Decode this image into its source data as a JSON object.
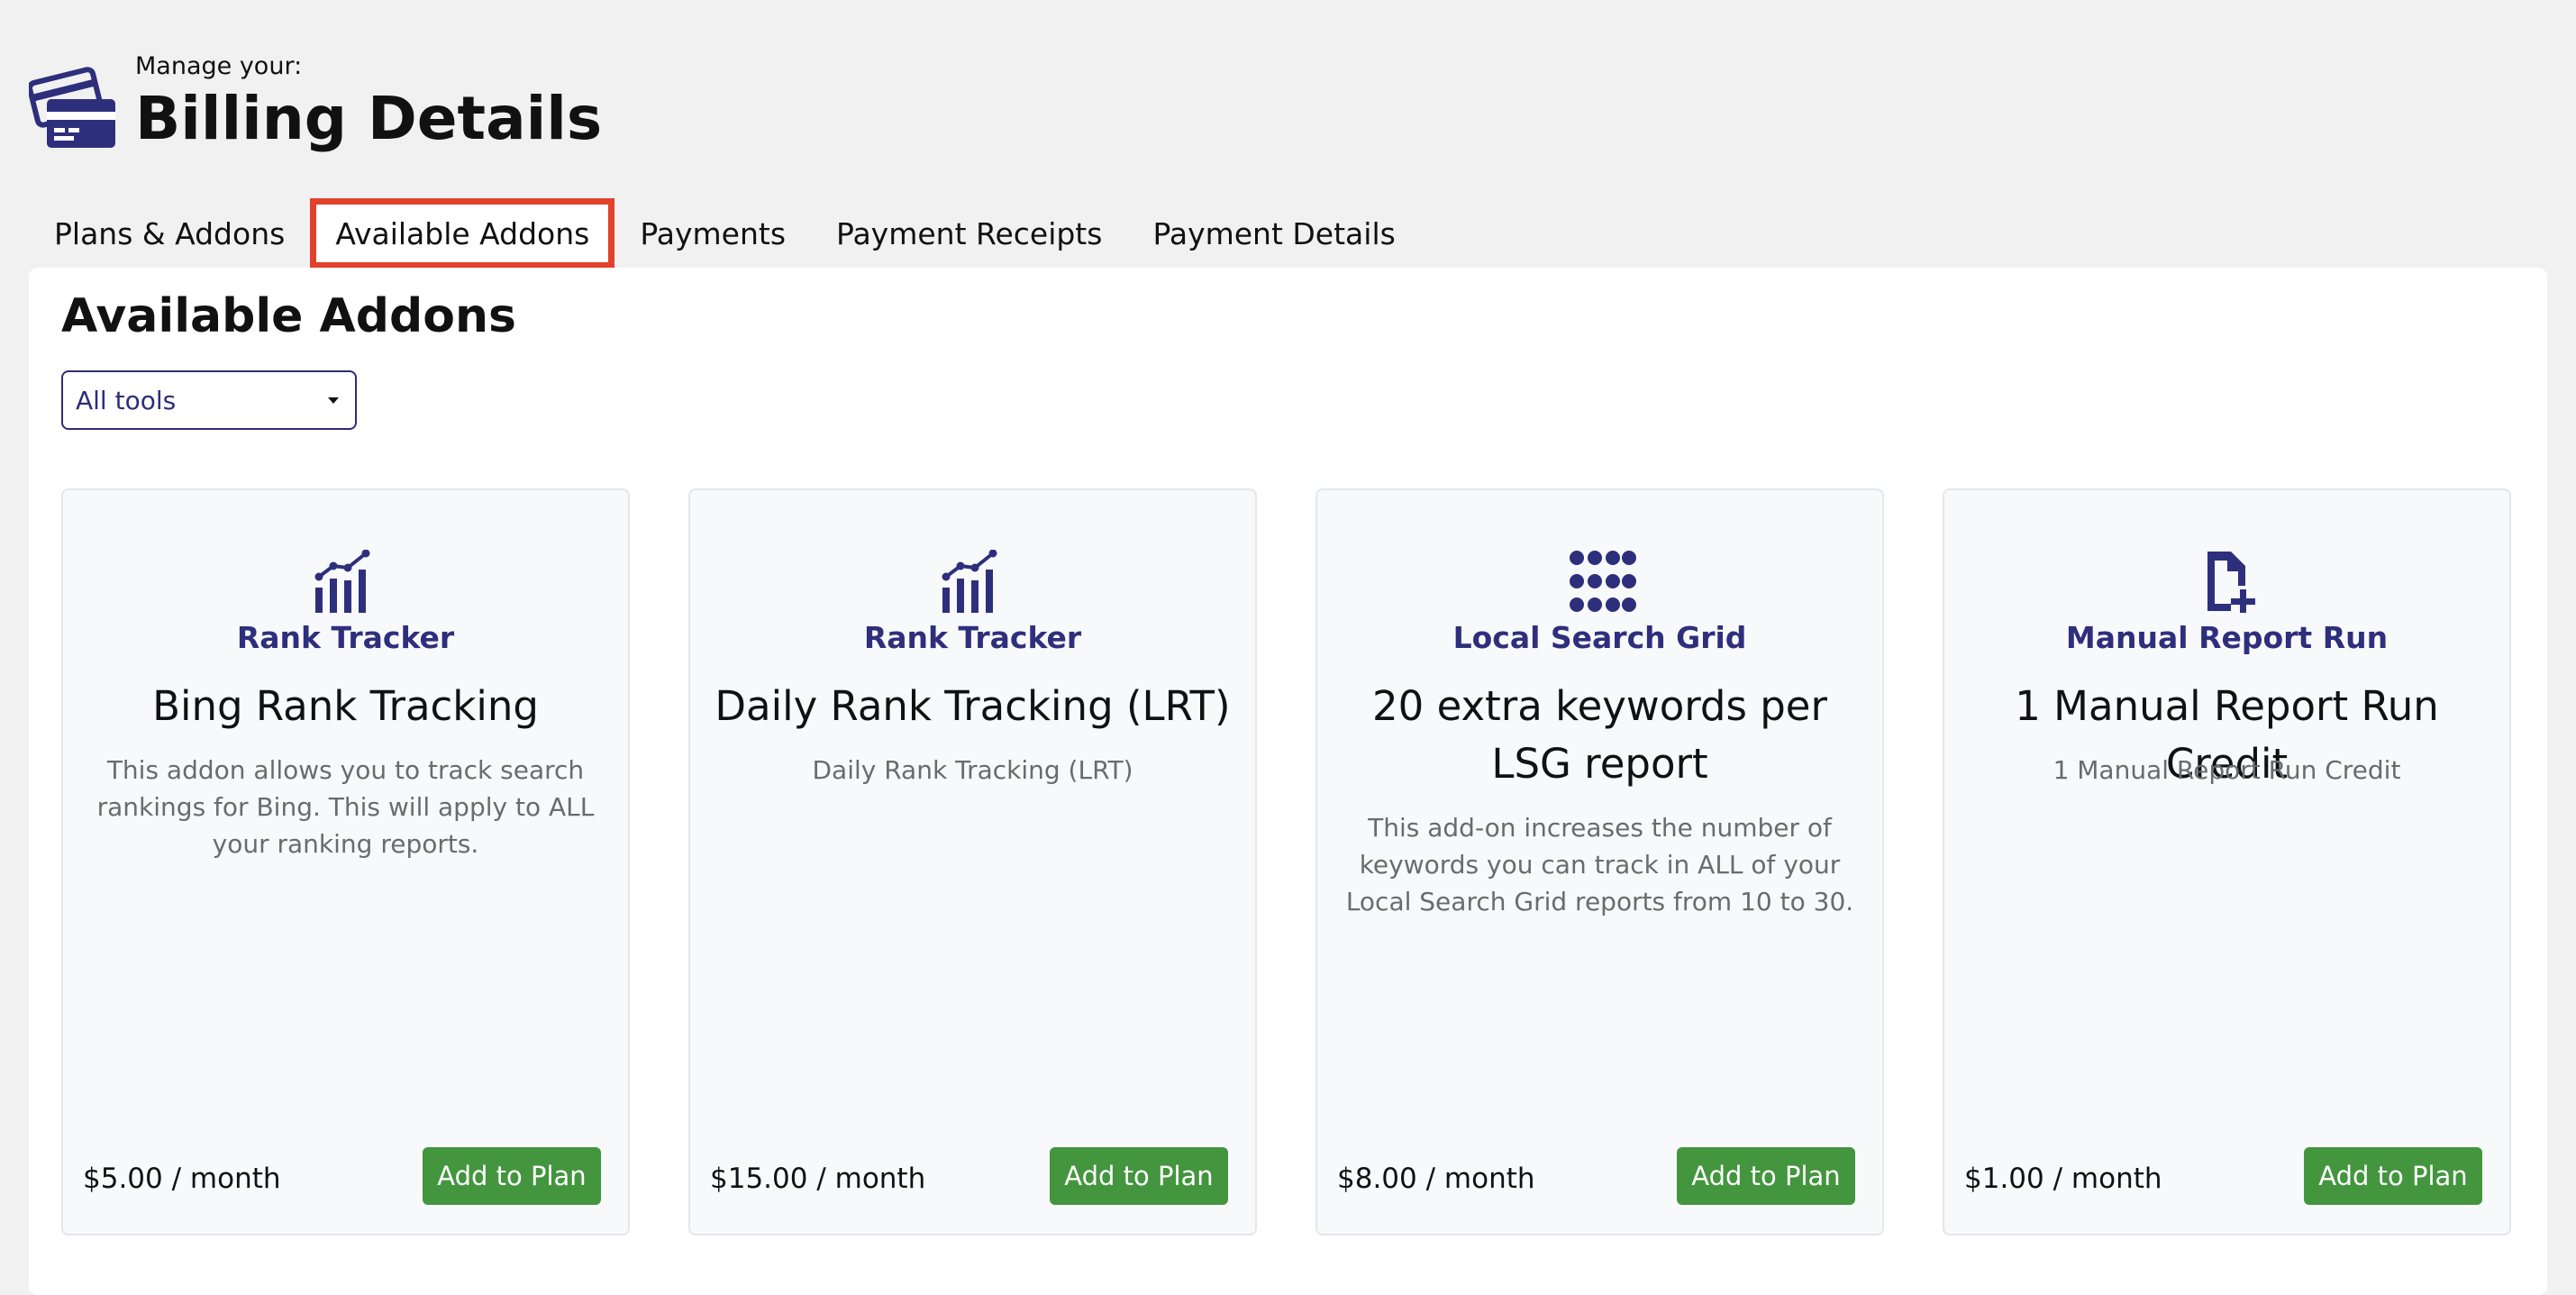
{
  "header": {
    "subtitle": "Manage your:",
    "title": "Billing Details",
    "icon": "credit-card-icon"
  },
  "tabs": [
    {
      "label": "Plans & Addons",
      "active": false
    },
    {
      "label": "Available Addons",
      "active": true
    },
    {
      "label": "Payments",
      "active": false
    },
    {
      "label": "Payment Receipts",
      "active": false
    },
    {
      "label": "Payment Details",
      "active": false
    }
  ],
  "panel": {
    "title": "Available Addons",
    "filter": {
      "selected": "All tools"
    }
  },
  "addons": [
    {
      "icon": "bar-chart-icon",
      "category": "Rank Tracker",
      "name": "Bing Rank Tracking",
      "description": "This addon allows you to track search rankings for Bing. This will apply to ALL your ranking reports.",
      "price": "$5.00 / month",
      "button": "Add to Plan"
    },
    {
      "icon": "bar-chart-icon",
      "category": "Rank Tracker",
      "name": "Daily Rank Tracking (LRT)",
      "description": "Daily Rank Tracking (LRT)",
      "price": "$15.00 / month",
      "button": "Add to Plan"
    },
    {
      "icon": "dot-grid-icon",
      "category": "Local Search Grid",
      "name": "20 extra keywords per LSG report",
      "description": "This add-on increases the number of keywords you can track in ALL of your Local Search Grid reports from 10 to 30.",
      "price": "$8.00 / month",
      "button": "Add to Plan"
    },
    {
      "icon": "file-plus-icon",
      "category": "Manual Report Run",
      "name": "1 Manual Report Run Credit",
      "description": "1 Manual Report Run Credit",
      "price": "$1.00 / month",
      "button": "Add to Plan"
    }
  ],
  "colors": {
    "accent": "#2e2f7c",
    "button": "#43953e",
    "active_tab_outline": "#e2412c"
  }
}
